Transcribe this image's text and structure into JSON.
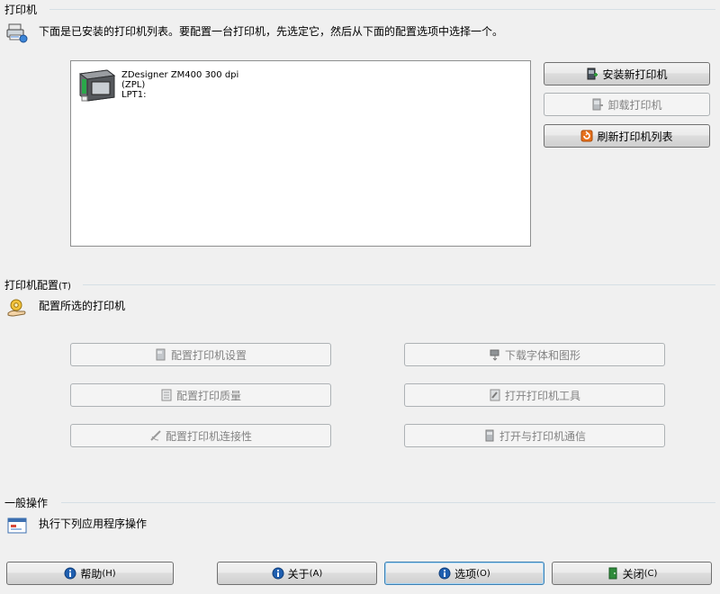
{
  "printers_section": {
    "title": "打印机",
    "description": "下面是已安装的打印机列表。要配置一台打印机，先选定它，然后从下面的配置选项中选择一个。",
    "printer": {
      "name": "ZDesigner ZM400 300 dpi",
      "language": "(ZPL)",
      "port": "LPT1:"
    },
    "install_button": "安装新打印机",
    "uninstall_button": "卸载打印机",
    "refresh_button": "刷新打印机列表"
  },
  "config_section": {
    "title": "打印机配置",
    "title_accel": "(T)",
    "description": "配置所选的打印机",
    "settings_button": "配置打印机设置",
    "quality_button": "配置打印质量",
    "connectivity_button": "配置打印机连接性",
    "download_button": "下载字体和图形",
    "tools_button": "打开打印机工具",
    "comm_button": "打开与打印机通信"
  },
  "general_section": {
    "title": "一般操作",
    "description": "执行下列应用程序操作"
  },
  "footer": {
    "help_label": "帮助",
    "help_accel": "(H)",
    "about_label": "关于",
    "about_accel": "(A)",
    "options_label": "选项",
    "options_accel": "(O)",
    "close_label": "关闭",
    "close_accel": "(C)"
  },
  "icons": {
    "printers": "printer-network-icon",
    "config": "gear-hand-icon",
    "general": "application-window-icon",
    "help": "info-circle-icon",
    "close": "exit-door-icon"
  },
  "colors": {
    "info_blue": "#1f5fb0",
    "refresh_orange": "#e8701a",
    "exit_green": "#2e8b3a"
  }
}
